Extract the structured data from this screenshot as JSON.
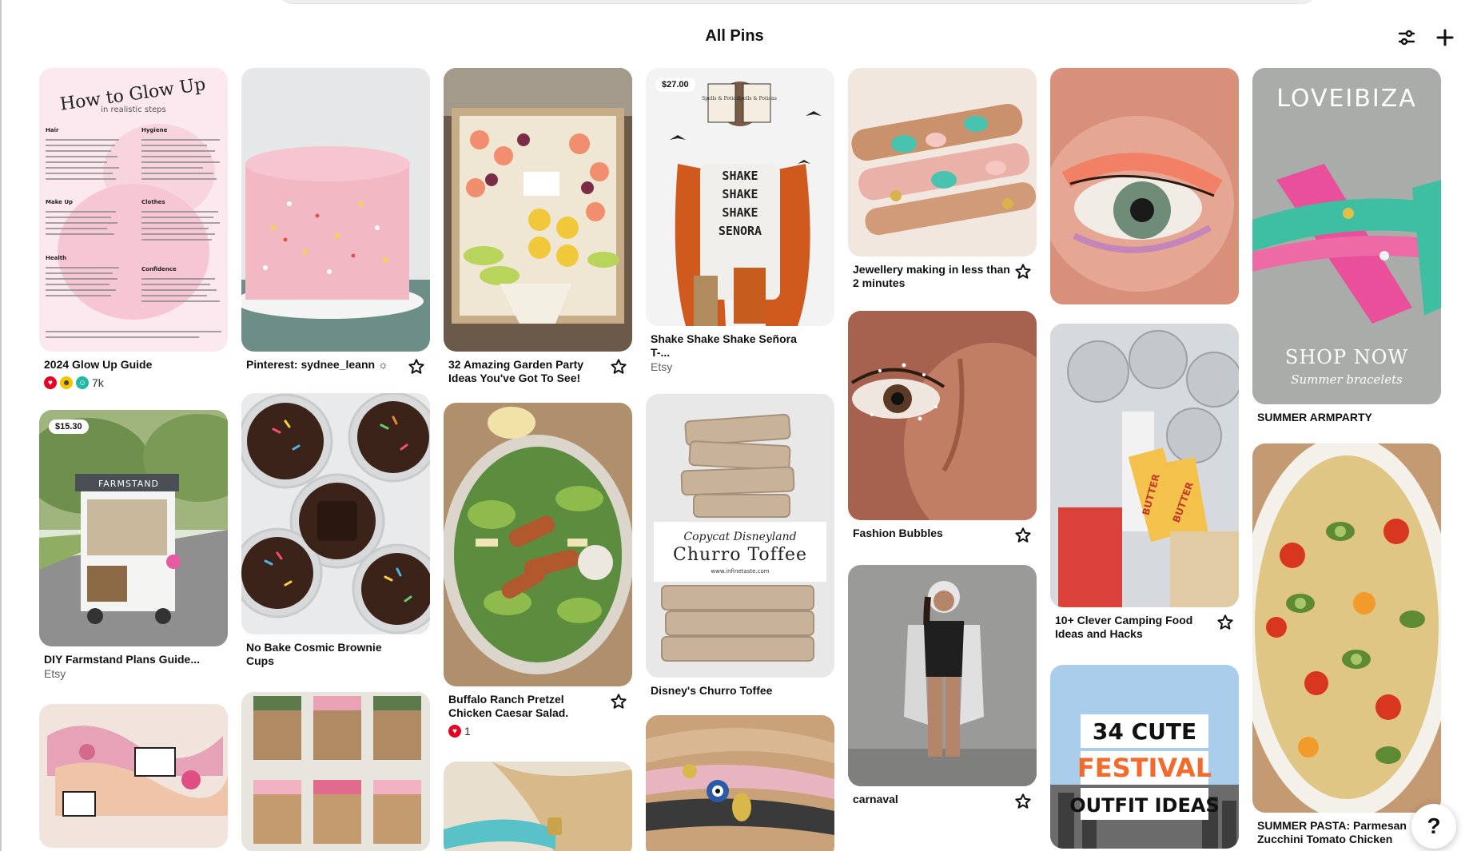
{
  "header": {
    "title": "All Pins",
    "filter_icon": "sliders-icon",
    "add_icon": "plus-icon"
  },
  "help_button": {
    "label": "?"
  },
  "pins": {
    "glow_up": {
      "title": "2024 Glow Up Guide",
      "reaction_count": "7k",
      "img_title": "How to Glow Up",
      "img_subtitle": "in realistic steps",
      "sections": [
        "Hair",
        "Hygiene",
        "Make Up",
        "Clothes",
        "Health",
        "Confidence"
      ]
    },
    "farmstand": {
      "title": "DIY Farmstand Plans Guide...",
      "source": "Etsy",
      "price": "$15.30",
      "img_text": "FARMSTAND"
    },
    "bracelets_pink": {},
    "cake": {
      "title": "Pinterest: sydnee_leann ☼"
    },
    "brownie": {
      "title": "No Bake Cosmic Brownie Cups"
    },
    "hair_ties": {},
    "garden_party": {
      "title": "32 Amazing Garden Party Ideas You've Got To See!"
    },
    "caesar": {
      "title": "Buffalo Ranch Pretzel Chicken Caesar Salad.",
      "reaction_count": "1"
    },
    "hair_bracelet": {},
    "shake_tee": {
      "title": "Shake Shake Shake Señora T-...",
      "source": "Etsy",
      "price": "$27.00",
      "shirt_text": "SHAKE SHAKE SHAKE SENORA",
      "book_text": "Spells & Potions"
    },
    "churro": {
      "title": "Disney's Churro Toffee",
      "img_line1": "Copycat Disneyland",
      "img_line2": "Churro Toffee",
      "img_url": "www.infinetaste.com"
    },
    "evil_eye": {},
    "jewellery": {
      "title": "Jewellery making in less than 2 minutes"
    },
    "bubbles": {
      "title": "Fashion Bubbles"
    },
    "carnaval": {
      "title": "carnaval"
    },
    "eye_makeup": {},
    "camping": {
      "title": "10+ Clever Camping Food Ideas and Hacks",
      "butter_text": "BUTTER"
    },
    "festival": {
      "line1": "34 CUTE",
      "line2": "FESTIVAL",
      "line3": "OUTFIT IDEAS"
    },
    "ibiza": {
      "title": "SUMMER ARMPARTY",
      "brand": "LOVEIBIZA",
      "cta": "SHOP NOW",
      "script": "Summer bracelets"
    },
    "pasta": {
      "title": "SUMMER PASTA: Parmesan Zucchini Tomato Chicken"
    }
  }
}
